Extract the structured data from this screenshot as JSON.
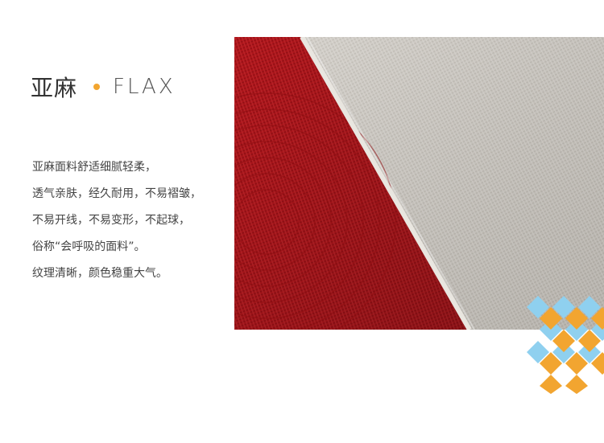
{
  "heading": {
    "title_cn": "亚麻",
    "title_en": "FLAX"
  },
  "description": {
    "lines": [
      "亚麻面料舒适细腻轻柔，",
      "透气亲肤，经久耐用，不易褶皱，",
      "不易开线，不易变形，不起球，",
      "俗称“会呼吸的面料”。",
      "纹理清晰，颜色稳重大气。"
    ]
  },
  "colors": {
    "accent_dot": "#f2a530",
    "fabric_red": "#b8161c",
    "fabric_natural": "#cfcbc4",
    "diamond_blue": "#8fd0ef",
    "diamond_orange": "#f2a530"
  }
}
